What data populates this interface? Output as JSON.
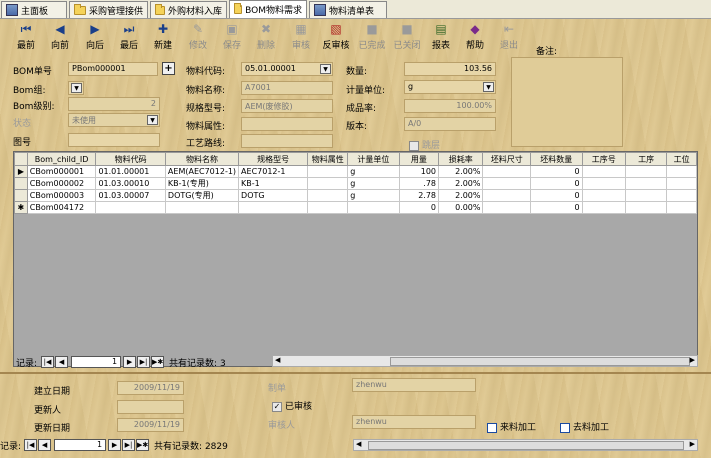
{
  "tabs": [
    {
      "label": "主面板",
      "icon": "sheet-icon",
      "active": false
    },
    {
      "label": "采购管理接供",
      "icon": "folder-icon",
      "active": false
    },
    {
      "label": "外购材料入库",
      "icon": "folder-icon",
      "active": false
    },
    {
      "label": "BOM物料需求",
      "icon": "folder-icon",
      "active": true
    },
    {
      "label": "物料清单表",
      "icon": "sheet-icon",
      "active": false
    }
  ],
  "toolbar": {
    "first": "最前",
    "prev": "向前",
    "next": "向后",
    "last": "最后",
    "new": "新建",
    "edit": "修改",
    "save": "保存",
    "delete": "删除",
    "audit": "审核",
    "unaudit": "反审核",
    "complete": "已完成",
    "closed": "已关闭",
    "report": "报表",
    "help": "帮助",
    "exit": "退出"
  },
  "form": {
    "bom_no_label": "BOM单号",
    "bom_no": "PBom000001",
    "bom_group_label": "Bom组:",
    "bom_level_label": "Bom级别:",
    "bom_level": "2",
    "status_label": "状态",
    "status": "未使用",
    "drawing_label": "图号",
    "item_code_label": "物料代码:",
    "item_code": "05.01.00001",
    "item_name_label": "物料名称:",
    "item_name": "A7001",
    "spec_label": "规格型号:",
    "spec": "AEM(废修胶)",
    "attr_label": "物料属性:",
    "route_label": "工艺路线:",
    "qty_label": "数量:",
    "qty": "103.56",
    "unit_label": "计量单位:",
    "unit": "g",
    "yield_label": "成品率:",
    "yield": "100.00%",
    "version_label": "版本:",
    "version": "A/0",
    "jump_label": "跳层",
    "remark_label": "备注:"
  },
  "grid": {
    "columns": [
      "Bom_child_ID",
      "物料代码",
      "物料名称",
      "规格型号",
      "物料属性",
      "计量单位",
      "用量",
      "损耗率",
      "坯料尺寸",
      "坯料数量",
      "工序号",
      "工序",
      "工位"
    ],
    "rows": [
      {
        "indicator": "▶",
        "id": "CBom000001",
        "code": "01.01.00001",
        "name": "AEM(AEC7012-1)",
        "spec": "AEC7012-1",
        "attr": "",
        "unit": "g",
        "qty": "100",
        "loss": "2.00%",
        "size": "",
        "count": "0"
      },
      {
        "indicator": "",
        "id": "CBom000002",
        "code": "01.03.00010",
        "name": "KB-1(专用)",
        "spec": "KB-1",
        "attr": "",
        "unit": "g",
        "qty": ".78",
        "loss": "2.00%",
        "size": "",
        "count": "0"
      },
      {
        "indicator": "",
        "id": "CBom000003",
        "code": "01.03.00007",
        "name": "DOTG(专用)",
        "spec": "DOTG",
        "attr": "",
        "unit": "g",
        "qty": "2.78",
        "loss": "2.00%",
        "size": "",
        "count": "0"
      },
      {
        "indicator": "✱",
        "id": "CBom004172",
        "code": "",
        "name": "",
        "spec": "",
        "attr": "",
        "unit": "",
        "qty": "0",
        "loss": "0.00%",
        "size": "",
        "count": "0"
      }
    ]
  },
  "detail_nav": {
    "label": "记录:",
    "current": "1",
    "total_text": "共有记录数: 3"
  },
  "footer": {
    "created_label": "建立日期",
    "created": "2009/11/19",
    "updater_label": "更新人",
    "updated_label": "更新日期",
    "updated": "2009/11/19",
    "maker_label": "制单",
    "maker": "zhenwu",
    "audited_label": "已审核",
    "auditor_label": "审核人",
    "auditor": "zhenwu",
    "incoming_label": "来料加工",
    "outgoing_label": "去料加工"
  },
  "main_nav": {
    "label": "记录:",
    "current": "1",
    "total_text": "共有记录数: 2829"
  }
}
